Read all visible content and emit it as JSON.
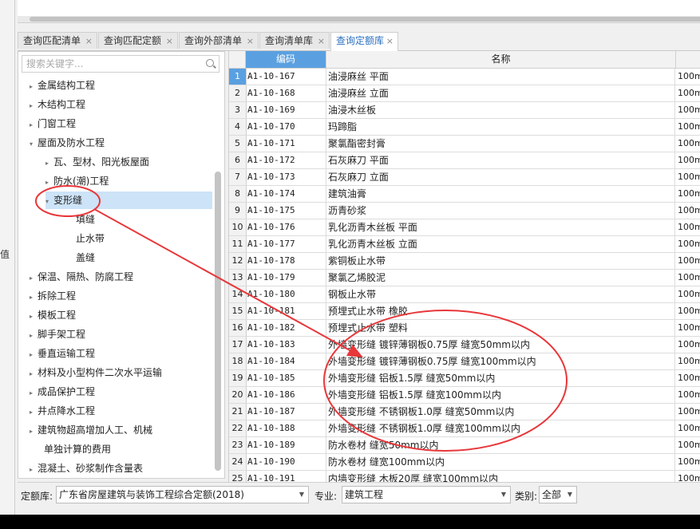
{
  "left_strip": {
    "value_label": "值"
  },
  "tabs": [
    {
      "label": "查询匹配清单",
      "close": "×"
    },
    {
      "label": "查询匹配定额",
      "close": "×"
    },
    {
      "label": "查询外部清单",
      "close": "×"
    },
    {
      "label": "查询清单库",
      "close": "×"
    },
    {
      "label": "查询定额库",
      "close": "×",
      "active": true
    }
  ],
  "search": {
    "placeholder": "搜索关键字..."
  },
  "tree": [
    {
      "label": "金属结构工程",
      "arrow": "▸"
    },
    {
      "label": "木结构工程",
      "arrow": "▸"
    },
    {
      "label": "门窗工程",
      "arrow": "▸"
    },
    {
      "label": "屋面及防水工程",
      "arrow": "▾"
    },
    {
      "label": "瓦、型材、阳光板屋面",
      "arrow": "▸"
    },
    {
      "label": "防水(潮)工程",
      "arrow": "▸"
    },
    {
      "label": "变形缝",
      "arrow": "▾",
      "selected": true
    },
    {
      "label": "填缝",
      "arrow": ""
    },
    {
      "label": "止水带",
      "arrow": ""
    },
    {
      "label": "盖缝",
      "arrow": ""
    },
    {
      "label": "保温、隔热、防腐工程",
      "arrow": "▸"
    },
    {
      "label": "拆除工程",
      "arrow": "▸"
    },
    {
      "label": "模板工程",
      "arrow": "▸"
    },
    {
      "label": "脚手架工程",
      "arrow": "▸"
    },
    {
      "label": "垂直运输工程",
      "arrow": "▸"
    },
    {
      "label": "材料及小型构件二次水平运输",
      "arrow": "▸"
    },
    {
      "label": "成品保护工程",
      "arrow": "▸"
    },
    {
      "label": "井点降水工程",
      "arrow": "▸"
    },
    {
      "label": "建筑物超高增加人工、机械",
      "arrow": "▸"
    },
    {
      "label": "单独计算的费用",
      "arrow": ""
    },
    {
      "label": "混凝土、砂浆制作含量表",
      "arrow": "▸"
    }
  ],
  "grid": {
    "headers": {
      "code": "编码",
      "name": "名称"
    },
    "rows": [
      {
        "no": "1",
        "code": "A1-10-167",
        "name": "油浸麻丝 平面",
        "unit": "100m"
      },
      {
        "no": "2",
        "code": "A1-10-168",
        "name": "油浸麻丝 立面",
        "unit": "100m"
      },
      {
        "no": "3",
        "code": "A1-10-169",
        "name": "油浸木丝板",
        "unit": "100m"
      },
      {
        "no": "4",
        "code": "A1-10-170",
        "name": "玛蹄脂",
        "unit": "100m"
      },
      {
        "no": "5",
        "code": "A1-10-171",
        "name": "聚氯酯密封膏",
        "unit": "100m"
      },
      {
        "no": "6",
        "code": "A1-10-172",
        "name": "石灰麻刀 平面",
        "unit": "100m"
      },
      {
        "no": "7",
        "code": "A1-10-173",
        "name": "石灰麻刀 立面",
        "unit": "100m"
      },
      {
        "no": "8",
        "code": "A1-10-174",
        "name": "建筑油膏",
        "unit": "100m"
      },
      {
        "no": "9",
        "code": "A1-10-175",
        "name": "沥青砂浆",
        "unit": "100m"
      },
      {
        "no": "10",
        "code": "A1-10-176",
        "name": "乳化沥青木丝板 平面",
        "unit": "100m"
      },
      {
        "no": "11",
        "code": "A1-10-177",
        "name": "乳化沥青木丝板 立面",
        "unit": "100m"
      },
      {
        "no": "12",
        "code": "A1-10-178",
        "name": "紫铜板止水带",
        "unit": "100m"
      },
      {
        "no": "13",
        "code": "A1-10-179",
        "name": "聚氯乙烯胶泥",
        "unit": "100m"
      },
      {
        "no": "14",
        "code": "A1-10-180",
        "name": "钢板止水带",
        "unit": "100m"
      },
      {
        "no": "15",
        "code": "A1-10-181",
        "name": "预埋式止水带 橡胶",
        "unit": "100m"
      },
      {
        "no": "16",
        "code": "A1-10-182",
        "name": "预埋式止水带 塑料",
        "unit": "100m"
      },
      {
        "no": "17",
        "code": "A1-10-183",
        "name": "外墙变形缝 镀锌薄钢板0.75厚 缝宽50mm以内",
        "unit": "100m"
      },
      {
        "no": "18",
        "code": "A1-10-184",
        "name": "外墙变形缝 镀锌薄钢板0.75厚 缝宽100mm以内",
        "unit": "100m"
      },
      {
        "no": "19",
        "code": "A1-10-185",
        "name": "外墙变形缝 铝板1.5厚 缝宽50mm以内",
        "unit": "100m"
      },
      {
        "no": "20",
        "code": "A1-10-186",
        "name": "外墙变形缝 铝板1.5厚 缝宽100mm以内",
        "unit": "100m"
      },
      {
        "no": "21",
        "code": "A1-10-187",
        "name": "外墙变形缝 不锈钢板1.0厚 缝宽50mm以内",
        "unit": "100m"
      },
      {
        "no": "22",
        "code": "A1-10-188",
        "name": "外墙变形缝 不锈钢板1.0厚 缝宽100mm以内",
        "unit": "100m"
      },
      {
        "no": "23",
        "code": "A1-10-189",
        "name": "防水卷材 缝宽50mm以内",
        "unit": "100m"
      },
      {
        "no": "24",
        "code": "A1-10-190",
        "name": "防水卷材 缝宽100mm以内",
        "unit": "100m"
      },
      {
        "no": "25",
        "code": "A1-10-191",
        "name": "内墙变形缝 木板20厚 缝宽100mm以内",
        "unit": "100m"
      }
    ]
  },
  "bottom": {
    "quota_label": "定额库:",
    "quota_value": "广东省房屋建筑与装饰工程综合定额(2018)",
    "major_label": "专业:",
    "major_value": "建筑工程",
    "category_label": "类别:",
    "category_value": "全部"
  },
  "annotation": {
    "color": "#e8373a"
  }
}
